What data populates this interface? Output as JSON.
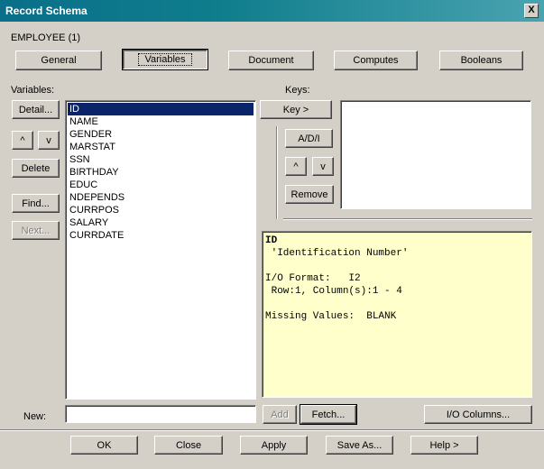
{
  "window": {
    "title": "Record Schema",
    "close_label": "X"
  },
  "record": {
    "name": "EMPLOYEE (1)"
  },
  "tabs": [
    {
      "label": "General"
    },
    {
      "label": "Variables"
    },
    {
      "label": "Document"
    },
    {
      "label": "Computes"
    },
    {
      "label": "Booleans"
    }
  ],
  "variables": {
    "label": "Variables:",
    "buttons": {
      "detail": "Detail...",
      "up": "^",
      "down": "v",
      "delete": "Delete",
      "find": "Find...",
      "next": "Next..."
    },
    "items": [
      "ID",
      "NAME",
      "GENDER",
      "MARSTAT",
      "SSN",
      "BIRTHDAY",
      "EDUC",
      "NDEPENDS",
      "CURRPOS",
      "SALARY",
      "CURRDATE"
    ],
    "selected": "ID"
  },
  "keys": {
    "label": "Keys:",
    "buttons": {
      "key": "Key >",
      "ad": "A/D/I",
      "up": "^",
      "down": "v",
      "remove": "Remove"
    }
  },
  "info": {
    "lines": [
      "ID",
      " 'Identification Number'",
      "",
      "I/O Format:   I2",
      " Row:1, Column(s):1 - 4",
      "",
      "Missing Values:  BLANK"
    ]
  },
  "new_field": {
    "label": "New:",
    "value": ""
  },
  "mid_buttons": {
    "add": "Add",
    "fetch": "Fetch...",
    "io_columns": "I/O Columns..."
  },
  "footer": {
    "ok": "OK",
    "close": "Close",
    "apply": "Apply",
    "save_as": "Save As...",
    "help": "Help >"
  }
}
